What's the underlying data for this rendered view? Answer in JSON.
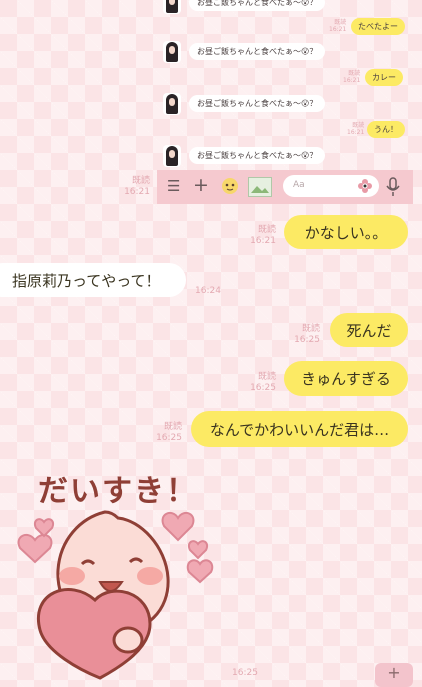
{
  "inset": {
    "messages": [
      {
        "type": "in",
        "text": "お昼ご飯ちゃんと食べたぁ〜😮？"
      },
      {
        "type": "out",
        "text": "たべたよー",
        "read": "既読",
        "time": "16:21"
      },
      {
        "type": "in",
        "text": "お昼ご飯ちゃんと食べたぁ〜😮？"
      },
      {
        "type": "out",
        "text": "カレー",
        "read": "既読",
        "time": "16:21"
      },
      {
        "type": "in",
        "text": "お昼ご飯ちゃんと食べたぁ〜😮？"
      },
      {
        "type": "out",
        "text": "うん！",
        "read": "既読",
        "time": "16:21"
      },
      {
        "type": "in",
        "text": "お昼ご飯ちゃんと食べたぁ〜😮？"
      }
    ],
    "input_placeholder": "Aa"
  },
  "chat": {
    "screenshot_meta": {
      "read": "既読",
      "time": "16:21"
    },
    "msg1": {
      "text": "かなしい。。",
      "read": "既読",
      "time": "16:21"
    },
    "msg2": {
      "text": "指原莉乃ってやって！",
      "time": "16:24"
    },
    "msg3": {
      "text": "死んだ",
      "read": "既読",
      "time": "16:25"
    },
    "msg4": {
      "text": "きゅんすぎる",
      "read": "既読",
      "time": "16:25"
    },
    "msg5": {
      "text": "なんでかわいいんだ君は…",
      "read": "既読",
      "time": "16:25"
    },
    "sticker": {
      "text": "だいすき！",
      "read": "既読",
      "time": "16:25"
    },
    "plus_label": "+"
  },
  "colors": {
    "bubble_out": "#fcea64",
    "bubble_in": "#ffffff",
    "meta": "#e3a9b1",
    "background": "#fbe4e6"
  }
}
